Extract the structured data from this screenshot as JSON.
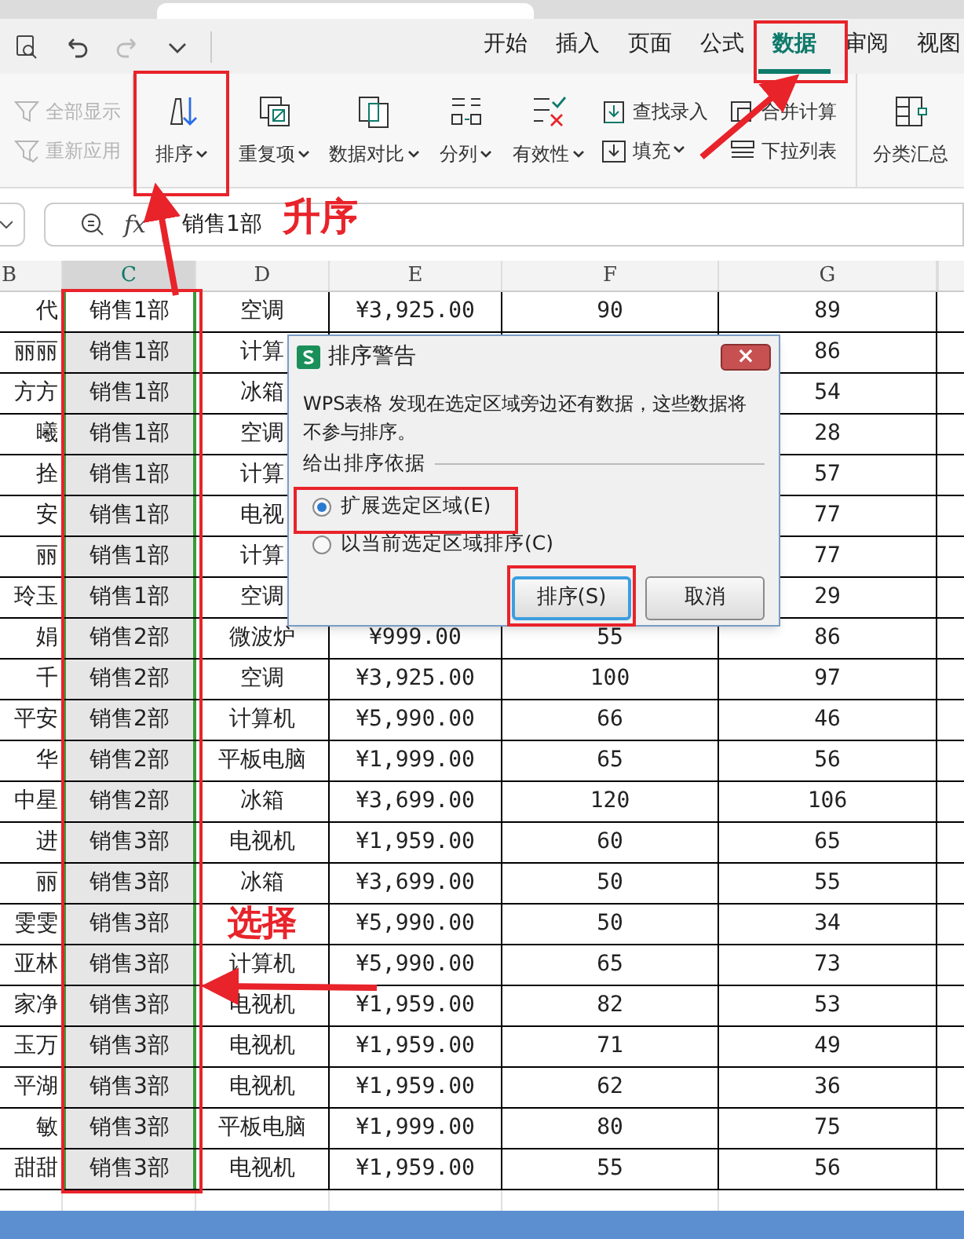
{
  "tabs": [
    {
      "label": "开始",
      "selected": false
    },
    {
      "label": "插入",
      "selected": false
    },
    {
      "label": "页面",
      "selected": false
    },
    {
      "label": "公式",
      "selected": false
    },
    {
      "label": "数据",
      "selected": true
    },
    {
      "label": "审阅",
      "selected": false
    },
    {
      "label": "视图",
      "selected": false
    }
  ],
  "quick_access": [
    {
      "disabled": false
    },
    {
      "disabled": false
    },
    {
      "disabled": true
    },
    {
      "disabled": false
    }
  ],
  "tool_columns": [
    [
      {
        "label": "全部显示",
        "disabled": true,
        "dropdown": false
      },
      {
        "label": "重新应用",
        "disabled": true,
        "dropdown": false
      }
    ],
    [
      {
        "label": "排序",
        "disabled": false,
        "dropdown": true
      }
    ],
    [
      {
        "label": "重复项",
        "disabled": false,
        "dropdown": true
      }
    ],
    [
      {
        "label": "数据对比",
        "disabled": false,
        "dropdown": true
      }
    ],
    [
      {
        "label": "分列",
        "disabled": false,
        "dropdown": true
      }
    ],
    [
      {
        "label": "有效性",
        "disabled": false,
        "dropdown": true
      }
    ],
    [
      {
        "label": "查找录入",
        "disabled": false,
        "dropdown": false
      },
      {
        "label": "填充",
        "disabled": false,
        "dropdown": true
      }
    ],
    [
      {
        "label": "合并计算",
        "disabled": false,
        "dropdown": false
      },
      {
        "label": "下拉列表",
        "disabled": false,
        "dropdown": false
      }
    ],
    [
      {
        "label": "分类汇总",
        "disabled": false,
        "dropdown": false
      }
    ]
  ],
  "formula_bar": {
    "fx": "fx",
    "value": "销售1部"
  },
  "sheet": {
    "columns": [
      {
        "label": "B",
        "selected": false
      },
      {
        "label": "C",
        "selected": true
      },
      {
        "label": "D",
        "selected": false
      },
      {
        "label": "E",
        "selected": false
      },
      {
        "label": "F",
        "selected": false
      },
      {
        "label": "G",
        "selected": false
      }
    ],
    "rows": [
      {
        "active": true,
        "cells": [
          "代",
          "销售1部",
          "空调",
          "¥3,925.00",
          "90",
          "89"
        ]
      },
      {
        "active": false,
        "cells": [
          "丽丽",
          "销售1部",
          "计算",
          null,
          null,
          "86"
        ]
      },
      {
        "active": false,
        "cells": [
          "方方",
          "销售1部",
          "冰箱",
          null,
          null,
          "54"
        ]
      },
      {
        "active": false,
        "cells": [
          "曦",
          "销售1部",
          "空调",
          null,
          null,
          "28"
        ]
      },
      {
        "active": false,
        "cells": [
          "拴",
          "销售1部",
          "计算",
          null,
          null,
          "57"
        ]
      },
      {
        "active": false,
        "cells": [
          "安",
          "销售1部",
          "电视",
          null,
          null,
          "77"
        ]
      },
      {
        "active": false,
        "cells": [
          "丽",
          "销售1部",
          "计算",
          null,
          null,
          "77"
        ]
      },
      {
        "active": false,
        "cells": [
          "玲玉",
          "销售1部",
          "空调",
          null,
          null,
          "29"
        ]
      },
      {
        "active": false,
        "cells": [
          "娟",
          "销售2部",
          "微波炉",
          "¥999.00",
          "55",
          "86"
        ]
      },
      {
        "active": false,
        "cells": [
          "千",
          "销售2部",
          "空调",
          "¥3,925.00",
          "100",
          "97"
        ]
      },
      {
        "active": false,
        "cells": [
          "平安",
          "销售2部",
          "计算机",
          "¥5,990.00",
          "66",
          "46"
        ]
      },
      {
        "active": false,
        "cells": [
          "华",
          "销售2部",
          "平板电脑",
          "¥1,999.00",
          "65",
          "56"
        ]
      },
      {
        "active": false,
        "cells": [
          "中星",
          "销售2部",
          "冰箱",
          "¥3,699.00",
          "120",
          "106"
        ]
      },
      {
        "active": false,
        "cells": [
          "进",
          "销售3部",
          "电视机",
          "¥1,959.00",
          "60",
          "65"
        ]
      },
      {
        "active": false,
        "cells": [
          "丽",
          "销售3部",
          "冰箱",
          "¥3,699.00",
          "50",
          "55"
        ]
      },
      {
        "active": false,
        "cells": [
          "雯雯",
          "销售3部",
          null,
          "¥5,990.00",
          "50",
          "34"
        ]
      },
      {
        "active": false,
        "cells": [
          "亚林",
          "销售3部",
          "计算机",
          "¥5,990.00",
          "65",
          "73"
        ]
      },
      {
        "active": false,
        "cells": [
          "家净",
          "销售3部",
          "电视机",
          "¥1,959.00",
          "82",
          "53"
        ]
      },
      {
        "active": false,
        "cells": [
          "玉万",
          "销售3部",
          "电视机",
          "¥1,959.00",
          "71",
          "49"
        ]
      },
      {
        "active": false,
        "cells": [
          "平湖",
          "销售3部",
          "电视机",
          "¥1,959.00",
          "62",
          "36"
        ]
      },
      {
        "active": false,
        "cells": [
          "敏",
          "销售3部",
          "平板电脑",
          "¥1,999.00",
          "80",
          "75"
        ]
      },
      {
        "active": false,
        "cells": [
          "甜甜",
          "销售3部",
          "电视机",
          "¥1,959.00",
          "55",
          "56"
        ]
      }
    ]
  },
  "dialog": {
    "title": "排序警告",
    "close": "×",
    "message": "WPS表格 发现在选定区域旁边还有数据，这些数据将不参与排序。",
    "group_label": "给出排序依据",
    "options": [
      {
        "label": "扩展选定区域(E)",
        "selected": true
      },
      {
        "label": "以当前选定区域排序(C)",
        "selected": false
      }
    ],
    "buttons": [
      {
        "label": "排序(S)",
        "default": true
      },
      {
        "label": "取消",
        "default": false
      }
    ]
  },
  "annotations": [
    {
      "text": "升序"
    },
    {
      "text": "选择"
    }
  ]
}
